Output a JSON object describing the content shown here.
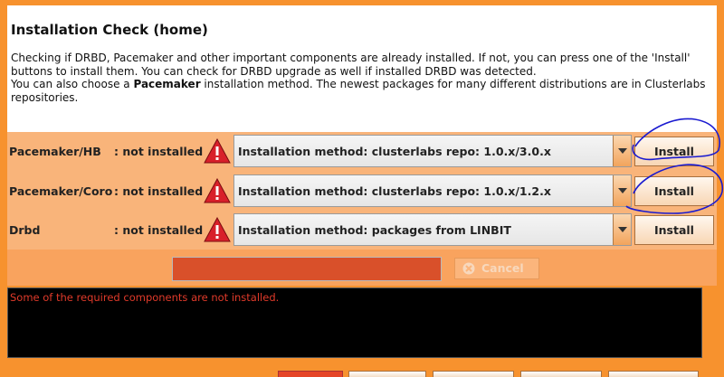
{
  "dialog": {
    "title": "Installation Check (home)",
    "description": {
      "line1": "Checking if DRBD, Pacemaker and other important components are already installed. If not, you can press one of the 'Install' buttons to install them. You can check for DRBD upgrade as well if installed DRBD was detected.",
      "line2_pre": "You can also choose a ",
      "line2_bold": "Pacemaker",
      "line2_post": " installation method. The newest packages for many different distributions are in Clusterlabs repositories."
    }
  },
  "components": [
    {
      "name": "Pacemaker/HB",
      "status": ": not installed",
      "method": "Installation method: clusterlabs repo: 1.0.x/3.0.x",
      "button": "Install"
    },
    {
      "name": "Pacemaker/Coro",
      "status": ": not installed",
      "method": "Installation method: clusterlabs repo: 1.0.x/1.2.x",
      "button": "Install"
    },
    {
      "name": "Drbd",
      "status": ": not installed",
      "method": "Installation method: packages from LINBIT",
      "button": "Install"
    }
  ],
  "progress": {
    "cancel_label": "Cancel"
  },
  "log": {
    "message": "Some of the required components are not installed."
  },
  "colors": {
    "background": "#f7922e",
    "row_panel": "#f9b47a",
    "progress_bar": "#d9502a",
    "log_text": "#e03a2a",
    "warning_icon": "#d8202a",
    "annotation_ink": "#1a1ad0"
  },
  "icons": {
    "status": "warning-triangle-icon",
    "dropdown": "chevron-down-icon",
    "cancel": "cancel-x-icon"
  }
}
